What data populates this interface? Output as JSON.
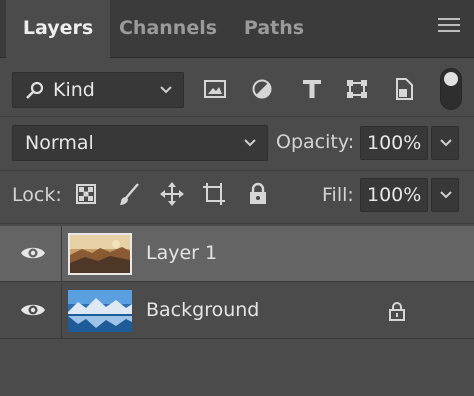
{
  "tabs": [
    {
      "label": "Layers",
      "active": true
    },
    {
      "label": "Channels",
      "active": false
    },
    {
      "label": "Paths",
      "active": false
    }
  ],
  "filter": {
    "kind_label": "Kind",
    "icons": [
      "image-filter-icon",
      "adjustment-filter-icon",
      "type-filter-icon",
      "shape-filter-icon",
      "smart-object-filter-icon"
    ]
  },
  "blend": {
    "mode": "Normal",
    "opacity_label": "Opacity:",
    "opacity_value": "100%"
  },
  "lock": {
    "label": "Lock:",
    "icons": [
      "lock-transparent-pixels-icon",
      "lock-image-pixels-icon",
      "lock-position-icon",
      "lock-artboard-icon",
      "lock-all-icon"
    ],
    "fill_label": "Fill:",
    "fill_value": "100%"
  },
  "layers": [
    {
      "name": "Layer 1",
      "selected": true,
      "visible": true,
      "locked": false
    },
    {
      "name": "Background",
      "selected": false,
      "visible": true,
      "locked": true
    }
  ],
  "colors": {
    "panel_bg": "#4b4b4b",
    "tabbar_bg": "#3b3b3b",
    "field_bg": "#383838",
    "selected_row": "#646464",
    "text": "#e4e4e4"
  }
}
